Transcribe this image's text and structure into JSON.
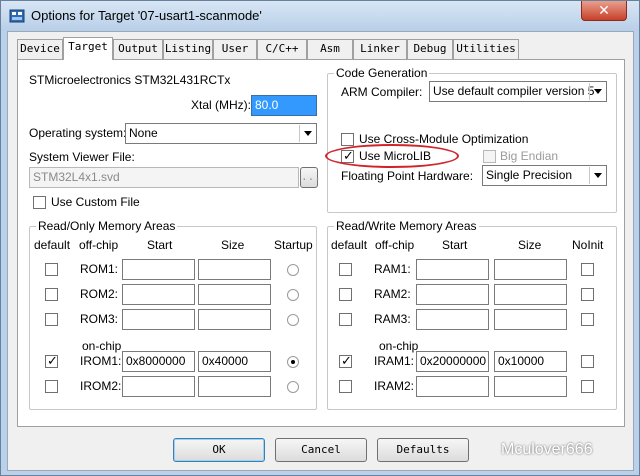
{
  "window": {
    "title": "Options for Target '07-usart1-scanmode'",
    "close_symbol": "✕"
  },
  "tabs": [
    {
      "label": "Device"
    },
    {
      "label": "Target"
    },
    {
      "label": "Output"
    },
    {
      "label": "Listing"
    },
    {
      "label": "User"
    },
    {
      "label": "C/C++"
    },
    {
      "label": "Asm"
    },
    {
      "label": "Linker"
    },
    {
      "label": "Debug"
    },
    {
      "label": "Utilities"
    }
  ],
  "active_tab": "Target",
  "device": {
    "name": "STMicroelectronics STM32L431RCTx"
  },
  "xtal": {
    "label": "Xtal (MHz):",
    "value": "80.0"
  },
  "os": {
    "label": "Operating system:",
    "value": "None"
  },
  "svd": {
    "label": "System Viewer File:",
    "value": "STM32L4x1.svd",
    "browse": "..."
  },
  "custom_file": {
    "label": "Use Custom File",
    "checked": false
  },
  "code_gen": {
    "legend": "Code Generation",
    "compiler_label": "ARM Compiler:",
    "compiler_value": "Use default compiler version 5",
    "cross_module": {
      "label": "Use Cross-Module Optimization",
      "checked": false
    },
    "microlib": {
      "label": "Use MicroLIB",
      "checked": true,
      "check_glyph": "✓"
    },
    "big_endian": {
      "label": "Big Endian",
      "checked": false
    },
    "fp_label": "Floating Point Hardware:",
    "fp_value": "Single Precision"
  },
  "ro_memory": {
    "legend": "Read/Only Memory Areas",
    "headers": {
      "default": "default",
      "offchip": "off-chip",
      "start": "Start",
      "size": "Size",
      "startup": "Startup"
    },
    "onchip_label": "on-chip",
    "rows": [
      {
        "name": "ROM1:",
        "start": "",
        "size": "",
        "default": false,
        "startup": false
      },
      {
        "name": "ROM2:",
        "start": "",
        "size": "",
        "default": false,
        "startup": false
      },
      {
        "name": "ROM3:",
        "start": "",
        "size": "",
        "default": false,
        "startup": false
      },
      {
        "name": "IROM1:",
        "start": "0x8000000",
        "size": "0x40000",
        "default": true,
        "startup": true
      },
      {
        "name": "IROM2:",
        "start": "",
        "size": "",
        "default": false,
        "startup": false
      }
    ]
  },
  "rw_memory": {
    "legend": "Read/Write Memory Areas",
    "headers": {
      "default": "default",
      "offchip": "off-chip",
      "start": "Start",
      "size": "Size",
      "noinit": "NoInit"
    },
    "onchip_label": "on-chip",
    "rows": [
      {
        "name": "RAM1:",
        "start": "",
        "size": "",
        "default": false
      },
      {
        "name": "RAM2:",
        "start": "",
        "size": "",
        "default": false
      },
      {
        "name": "RAM3:",
        "start": "",
        "size": "",
        "default": false
      },
      {
        "name": "IRAM1:",
        "start": "0x20000000",
        "size": "0x10000",
        "default": true
      },
      {
        "name": "IRAM2:",
        "start": "",
        "size": "",
        "default": false
      }
    ]
  },
  "buttons": {
    "ok": "OK",
    "cancel": "Cancel",
    "defaults": "Defaults"
  },
  "watermark": "Mculover666",
  "colors": {
    "highlight": "#d0242a",
    "title_bar": "#b9d1ea",
    "close": "#c7412b"
  }
}
